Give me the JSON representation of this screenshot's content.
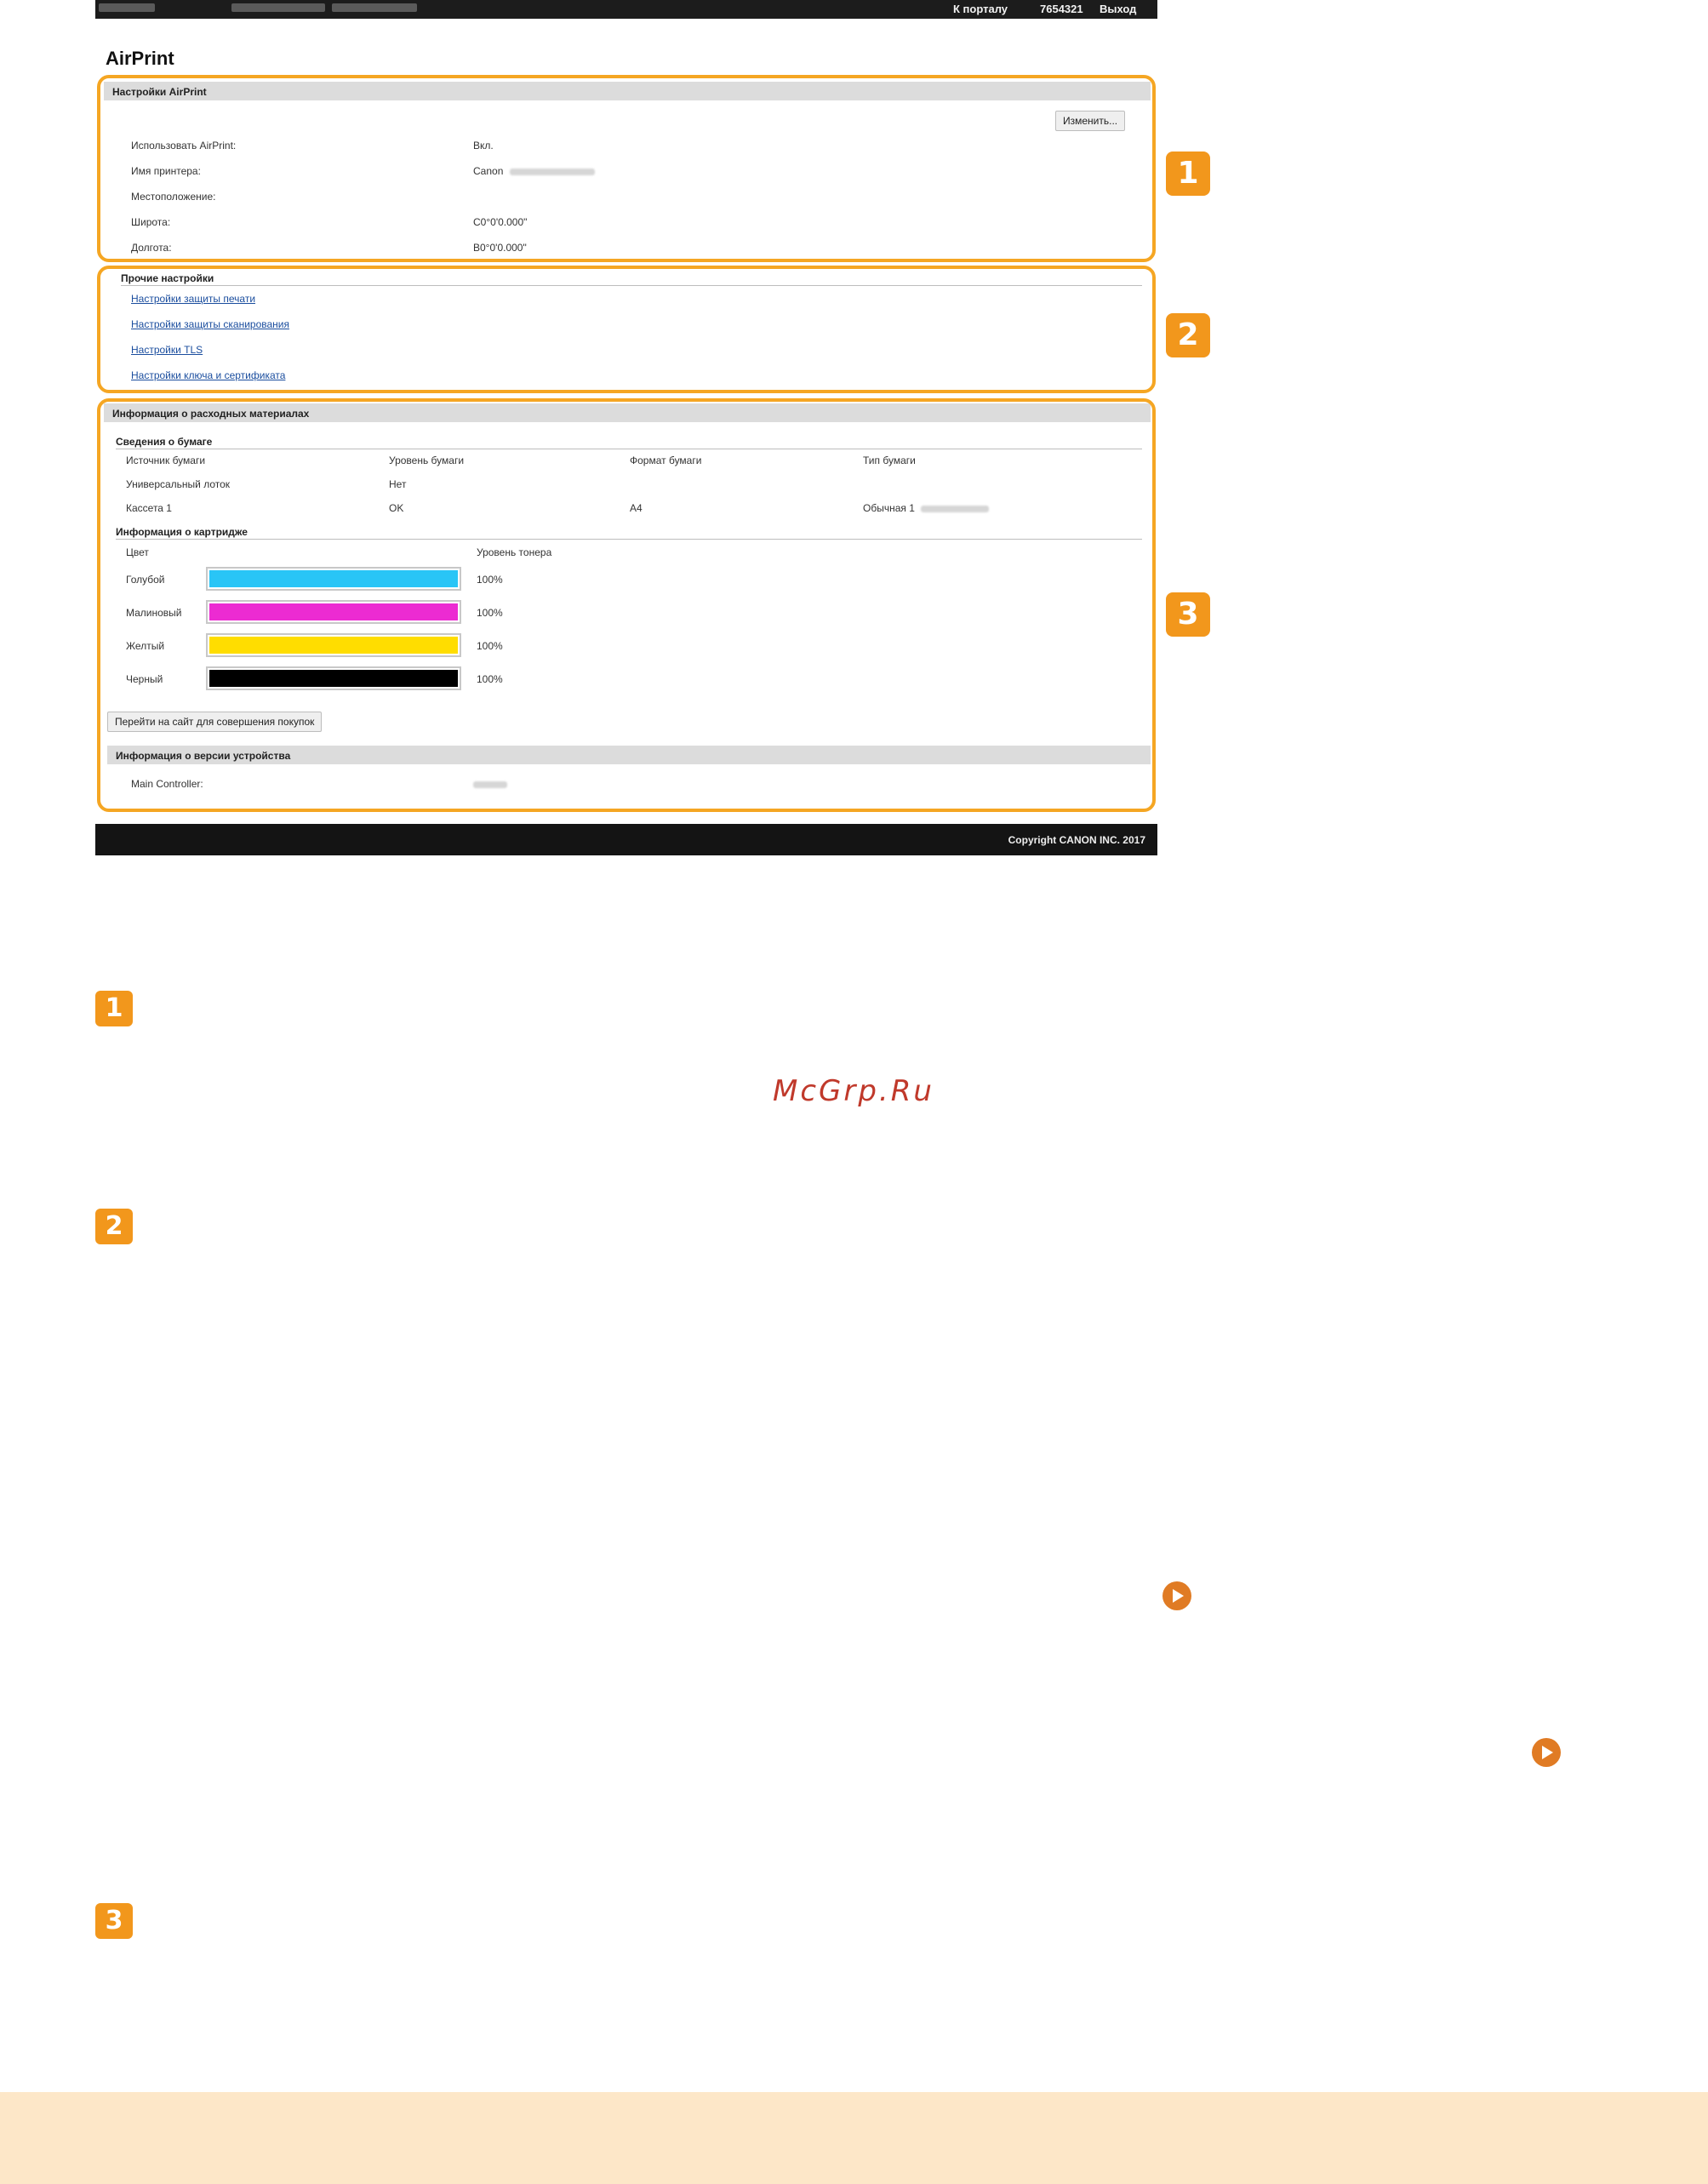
{
  "header": {
    "portal_link": "К порталу",
    "user_id": "7654321",
    "logout": "Выход"
  },
  "app_title": "AirPrint",
  "airprint_settings": {
    "title": "Настройки AirPrint",
    "edit_button": "Изменить...",
    "rows": [
      {
        "label": "Использовать AirPrint:",
        "value": "Вкл."
      },
      {
        "label": "Имя принтера:",
        "value": "Canon"
      },
      {
        "label": "Местоположение:",
        "value": ""
      },
      {
        "label": "Широта:",
        "value": "C0°0'0.000\""
      },
      {
        "label": "Долгота:",
        "value": "В0°0'0.000\""
      }
    ]
  },
  "other_settings": {
    "title": "Прочие настройки",
    "links": [
      "Настройки защиты печати",
      "Настройки защиты сканирования",
      "Настройки TLS",
      "Настройки ключа и сертификата"
    ]
  },
  "consumables": {
    "title": "Информация о расходных материалах",
    "paper_title": "Сведения о бумаге",
    "paper_headers": [
      "Источник бумаги",
      "Уровень бумаги",
      "Формат бумаги",
      "Тип бумаги"
    ],
    "paper_rows": [
      [
        "Универсальный лоток",
        "Нет",
        "",
        ""
      ],
      [
        "Кассета 1",
        "OK",
        "A4",
        "Обычная 1"
      ]
    ],
    "cartridge_title": "Информация о картридже",
    "cartridge_headers": [
      "Цвет",
      "Уровень тонера"
    ],
    "cartridges": [
      {
        "name": "Голубой",
        "level": "100%",
        "fraction": 1.0,
        "color": "#29c5f6"
      },
      {
        "name": "Малиновый",
        "level": "100%",
        "fraction": 1.0,
        "color": "#ec2bd2"
      },
      {
        "name": "Желтый",
        "level": "100%",
        "fraction": 1.0,
        "color": "#ffdd00"
      },
      {
        "name": "Черный",
        "level": "100%",
        "fraction": 1.0,
        "color": "#000000"
      }
    ],
    "shop_button": "Перейти на сайт для совершения покупок"
  },
  "version": {
    "title": "Информация о версии устройства",
    "label": "Main Controller:"
  },
  "footer": {
    "copyright": "Copyright CANON INC. 2017"
  },
  "callouts": [
    "1",
    "2",
    "3"
  ],
  "watermark": "McGrp.Ru",
  "colors": {
    "accent": "#f2971c",
    "outline": "#f5a623",
    "link": "#1a4d9e",
    "page_footer": "#fde7c8"
  }
}
